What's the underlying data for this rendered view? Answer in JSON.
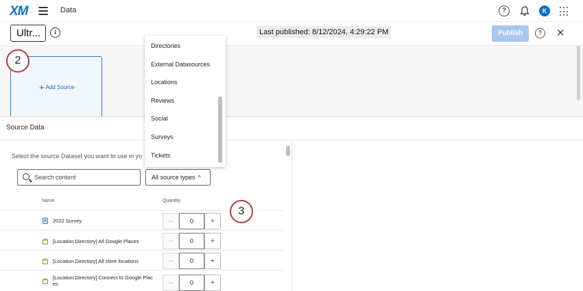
{
  "topbar": {
    "logo": "XM",
    "title": "Data",
    "avatar_letter": "K"
  },
  "subbar": {
    "project_name": "Ultr...",
    "info_glyph": "i",
    "last_published": "Last published: 8/12/2024, 4:29:22 PM",
    "publish_label": "Publish",
    "help_glyph": "?",
    "close_glyph": "✕"
  },
  "canvas": {
    "step_2": "2",
    "add_source_label": "Add Source"
  },
  "panel": {
    "title": "Source Data",
    "instructions": "Select the source Dataset you want to use in yo",
    "search_placeholder": "Search content",
    "type_filter": "All source types",
    "col_name": "Name",
    "col_quantity": "Quantity",
    "step_3": "3",
    "rows": [
      {
        "label": "2022 Survey",
        "quantity": "0",
        "icon": "survey-icon"
      },
      {
        "label": "[Location Directory] All Google Places",
        "quantity": "0",
        "icon": "location-directory-icon"
      },
      {
        "label": "[Location Directory] All store locations",
        "quantity": "0",
        "icon": "location-directory-icon"
      },
      {
        "label_line1": "[Location Directory] Connect to Google Plac",
        "label_line2": "es",
        "quantity": "0",
        "icon": "location-directory-icon"
      }
    ]
  },
  "dropdown": {
    "items": [
      "Directories",
      "External Datasources",
      "Locations",
      "Reviews",
      "Social",
      "Surveys",
      "Tickets"
    ]
  },
  "colors": {
    "brand": "#0b6ed0",
    "publish_disabled": "#a9c8ef",
    "step_ring": "#b23a3a",
    "card_border": "#2d7ad6"
  }
}
